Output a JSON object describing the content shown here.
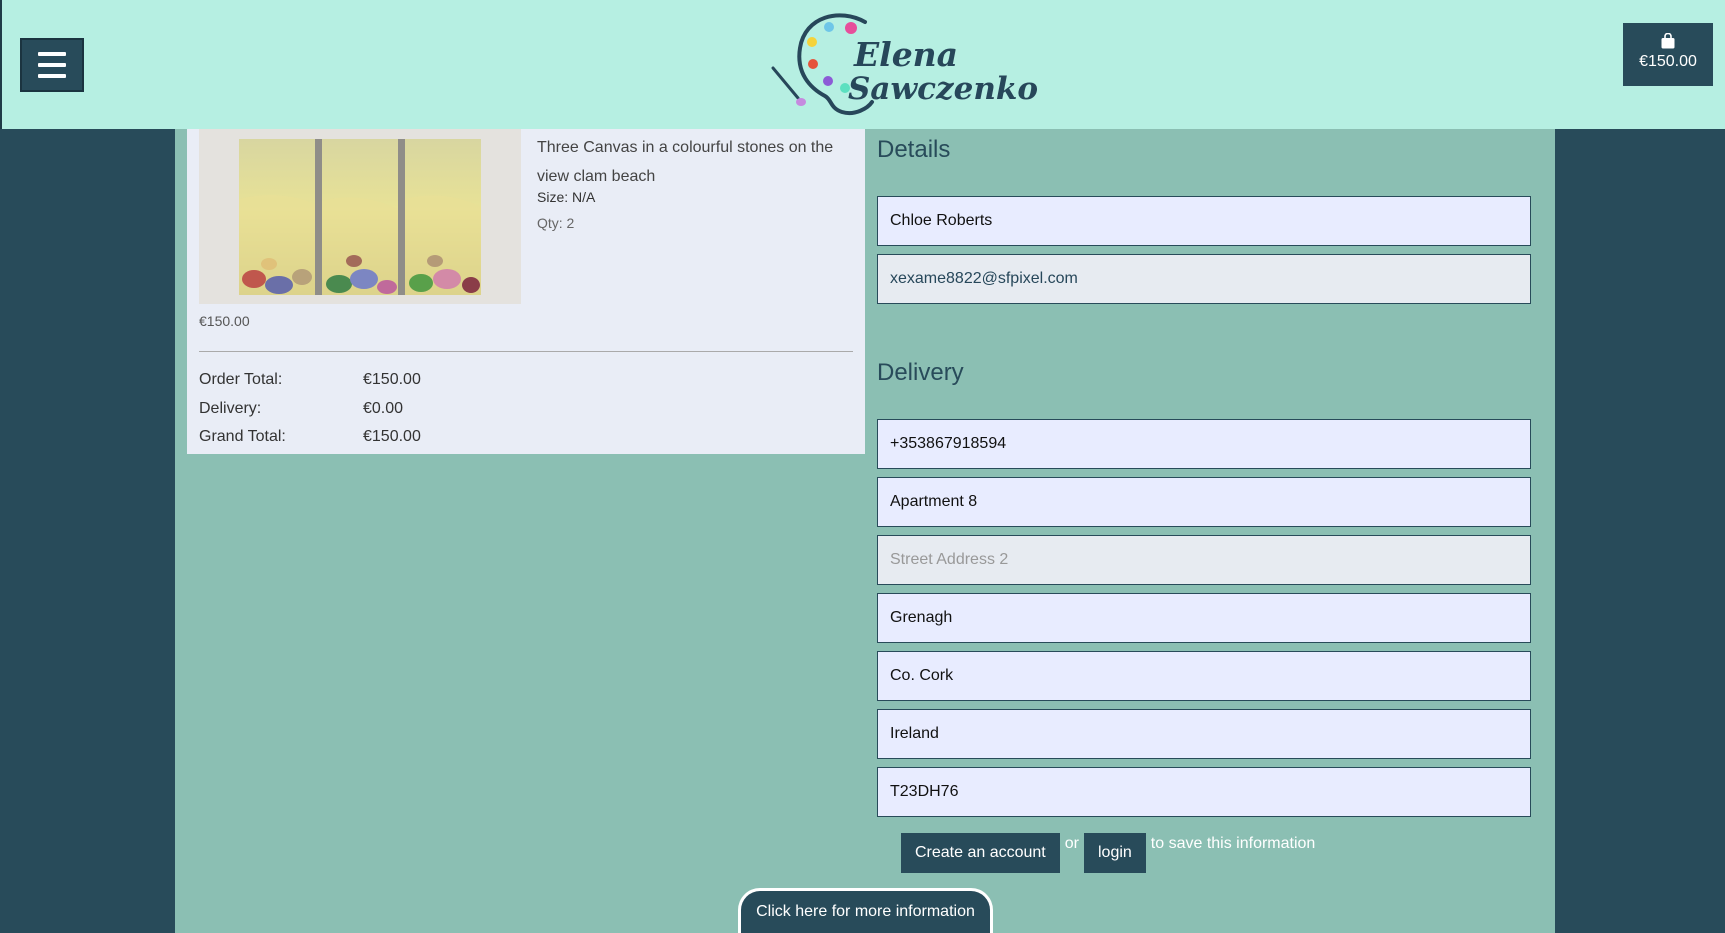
{
  "header": {
    "logo_line1": "Elena",
    "logo_line2": "Sawczenko",
    "cart_total": "€150.00"
  },
  "summary": {
    "product_name": "Three Canvas in a colourful stones on the view clam beach",
    "size": "Size: N/A",
    "qty": "Qty: 2",
    "price": "€150.00",
    "order_total_label": "Order Total:",
    "order_total": "€150.00",
    "delivery_label": "Delivery:",
    "delivery": "€0.00",
    "grand_total_label": "Grand Total:",
    "grand_total": "€150.00"
  },
  "details": {
    "title": "Details",
    "full_name": "Chloe Roberts",
    "email": "xexame8822@sfpixel.com"
  },
  "delivery": {
    "title": "Delivery",
    "phone": "+353867918594",
    "street1": "Apartment 8",
    "street2_placeholder": "Street Address 2",
    "town": "Grenagh",
    "county": "Co. Cork",
    "country": "Ireland",
    "postcode": "T23DH76"
  },
  "account": {
    "create_label": "Create an account",
    "or": "or",
    "login_label": "login",
    "suffix": "to save this information"
  },
  "info_button": "Click here for more information",
  "colors": {
    "header_bg": "#b6efe2",
    "navy": "#284b5a",
    "content_bg": "#8bbfb3",
    "summary_bg": "#e9edf6"
  }
}
